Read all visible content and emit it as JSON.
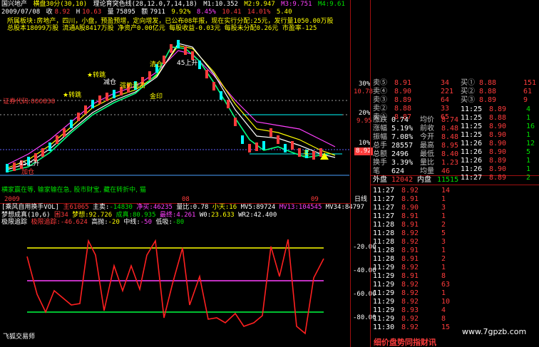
{
  "header": {
    "stock_name": "国兴地产",
    "period": "横盘30分(30,10)",
    "indicator": "理论育突色线(28,12.0,7,14,18)",
    "m1": "M1:10.352",
    "m2": "M2:9.947",
    "m3": "M3:9.751",
    "m4": "M4:9.61",
    "date": "2009/07/08",
    "price_label": "收",
    "price": "8.92",
    "high_label": "H",
    "high": "10.63",
    "amount_label": "量",
    "amount": "75895",
    "turnover_label": "额",
    "turnover": "7911",
    "change_pct": "9.92%",
    "range_pct": "8.45%",
    "low_pct": "10.41",
    "last_pct": "14.01%",
    "tail": "5.40",
    "info_line1": "所属板块:房地产，四川，小盘，预盈预增，定向增发，已公布08年报，现在实行分配:25元，发行量1050.00万股",
    "info_line2": "总股本18099万股    流通A股8417万股    净资产0.00亿元    每股收益-0.03元    每股未分配0.26元    市盈率-125"
  },
  "chart_labels": {
    "signal_1": "强势追击",
    "signal_2": "清仓",
    "signal_3": "金印",
    "signal_4": "45上升",
    "signal_5": "加仓",
    "signal_6": "证券代码:000838",
    "signal_7": "买",
    "signal_8": "减仓",
    "signal_9": "45上升",
    "signal_10": "★转跳",
    "signal_11": "★转跳"
  },
  "scale_right": [
    "30%",
    "10.78",
    "20%",
    "9.95",
    "10%",
    "8.92"
  ],
  "current_price_tag": "8.92",
  "scroll_text": "横家赢在等, 输家输在急, 股市财宝, 藏在转折中, 猫",
  "scroll_text_tail": "日线",
  "xaxis": {
    "left": "2009",
    "mid": "08",
    "right": "09"
  },
  "indicator_bar": {
    "name": "[乘风自用换手VOL]",
    "v1": "主",
    "v1_val": "61065",
    "v2": "主卖:",
    "v2_val": "-14830",
    "v3": "净买:",
    "v3_val": "46235",
    "v4": "量比:",
    "v4_val": "0.78",
    "v5": "小天:",
    "v5_val": "16",
    "v6": "MV5:89724",
    "v7": "MV13:104545",
    "v8": "MV34:84797"
  },
  "indicator_bar2": {
    "name": "梦想成真(10,6)",
    "v1": "困",
    "v1_val": "34",
    "v2": "梦想:",
    "v2_val": "92.726",
    "v3": "成真:",
    "v3_val": "80.935",
    "v4": "最终:",
    "v4_val": "4.261",
    "v5": "W0:",
    "v5_val": "23.633",
    "v6": "WR2:42.400"
  },
  "indicator_bar3": {
    "name": "极限追踪",
    "v1": "极限追踪:",
    "v1_val": "-46.624",
    "v2": "高抛:",
    "v2_val": "-20",
    "v3": "中线:",
    "v3_val": "-50",
    "v4": "低吸:",
    "v4_val": "-80"
  },
  "osc_scale": [
    "-20.00",
    "-40.00",
    "-60.00",
    "-80.00"
  ],
  "orderbook": {
    "sell": [
      {
        "label": "卖⑤",
        "price": "8.91",
        "vol": "34"
      },
      {
        "label": "卖④",
        "price": "8.90",
        "vol": "221"
      },
      {
        "label": "卖③",
        "price": "8.89",
        "vol": "64"
      },
      {
        "label": "卖②",
        "price": "8.88",
        "vol": "33"
      },
      {
        "label": "卖①",
        "price": "8.87",
        "vol": "65"
      }
    ],
    "buy_right": [
      {
        "label": "买①",
        "price": "8.88",
        "vol": "151"
      },
      {
        "label": "买②",
        "price": "8.88",
        "vol": "61"
      },
      {
        "label": "买③",
        "price": "8.89",
        "vol": "9"
      }
    ]
  },
  "stats": [
    {
      "k": "涨跌",
      "v": "0.74",
      "k2": "均价",
      "v2": "8.74"
    },
    {
      "k": "涨幅",
      "v": "5.19%",
      "k2": "前收",
      "v2": "8.48"
    },
    {
      "k": "振幅",
      "v": "7.08%",
      "k2": "今开",
      "v2": "8.48"
    },
    {
      "k": "总手",
      "v": "28557",
      "k2": "最高",
      "v2": "8.95"
    },
    {
      "k": "总额",
      "v": "2496",
      "k2": "最低",
      "v2": "8.40"
    },
    {
      "k": "换手",
      "v": "3.39%",
      "k2": "量比",
      "v2": "1.23"
    },
    {
      "k": "笔",
      "v": "624",
      "k2": "均量",
      "v2": "46"
    }
  ],
  "disk": {
    "out_label": "外盘",
    "out_val": "12042",
    "in_label": "内盘",
    "in_val": "11515"
  },
  "ticks_right": [
    {
      "t": "11:25",
      "p": "8.89",
      "v": "4"
    },
    {
      "t": "11:25",
      "p": "8.88",
      "v": "1"
    },
    {
      "t": "11:25",
      "p": "8.90",
      "v": "16"
    },
    {
      "t": "11:25",
      "p": "8.90",
      "v": "1"
    },
    {
      "t": "11:26",
      "p": "8.90",
      "v": "12"
    },
    {
      "t": "11:26",
      "p": "8.90",
      "v": "5"
    },
    {
      "t": "11:26",
      "p": "8.89",
      "v": "1"
    },
    {
      "t": "11:26",
      "p": "8.90",
      "v": "1"
    },
    {
      "t": "11:27",
      "p": "8.89",
      "v": "2"
    }
  ],
  "ticks": [
    {
      "t": "11:27",
      "p": "8.92",
      "v": "14"
    },
    {
      "t": "11:27",
      "p": "8.91",
      "v": "1"
    },
    {
      "t": "11:27",
      "p": "8.90",
      "v": "3"
    },
    {
      "t": "11:27",
      "p": "8.91",
      "v": "1"
    },
    {
      "t": "11:28",
      "p": "8.91",
      "v": "2"
    },
    {
      "t": "11:28",
      "p": "8.92",
      "v": "5"
    },
    {
      "t": "11:28",
      "p": "8.92",
      "v": "3"
    },
    {
      "t": "11:28",
      "p": "8.91",
      "v": "1"
    },
    {
      "t": "11:28",
      "p": "8.91",
      "v": "2"
    },
    {
      "t": "11:29",
      "p": "8.92",
      "v": "1"
    },
    {
      "t": "11:29",
      "p": "8.91",
      "v": "8"
    },
    {
      "t": "11:29",
      "p": "8.92",
      "v": "63"
    },
    {
      "t": "11:29",
      "p": "8.92",
      "v": "1"
    },
    {
      "t": "11:29",
      "p": "8.92",
      "v": "10"
    },
    {
      "t": "11:29",
      "p": "8.93",
      "v": "4"
    },
    {
      "t": "11:29",
      "p": "8.92",
      "v": "8"
    },
    {
      "t": "11:30",
      "p": "8.92",
      "v": "15"
    }
  ],
  "footer": {
    "left": "飞狐交易师",
    "brand": "细价盘势同指财讯",
    "site": "www.7gpzb.com"
  },
  "colors": {
    "up": "#ff3c3c",
    "down": "#00e000",
    "grid": "#a01010",
    "accent": "#ffff00"
  }
}
